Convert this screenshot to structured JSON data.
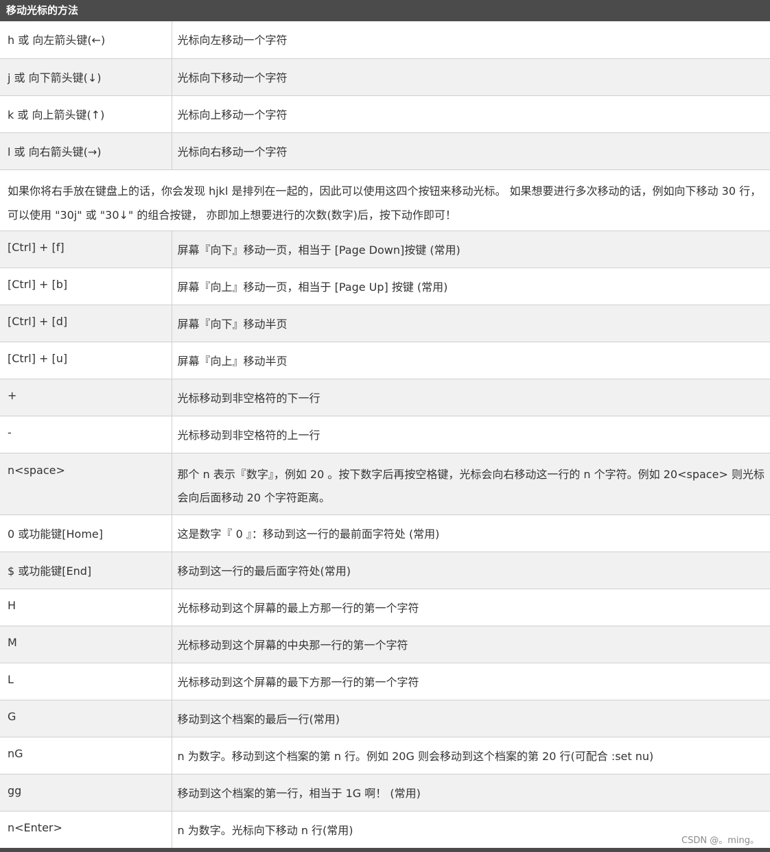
{
  "header": {
    "title": "移动光标的方法"
  },
  "rows": [
    {
      "key": "h 或 向左箭头键(←)",
      "desc": "光标向左移动一个字符"
    },
    {
      "key": "j 或 向下箭头键(↓)",
      "desc": "光标向下移动一个字符"
    },
    {
      "key": "k 或 向上箭头键(↑)",
      "desc": "光标向上移动一个字符"
    },
    {
      "key": "l 或 向右箭头键(→)",
      "desc": "光标向右移动一个字符"
    },
    {
      "note": "如果你将右手放在键盘上的话，你会发现 hjkl 是排列在一起的，因此可以使用这四个按钮来移动光标。 如果想要进行多次移动的话，例如向下移动 30 行，可以使用 \"30j\" 或 \"30↓\" 的组合按键， 亦即加上想要进行的次数(数字)后，按下动作即可！"
    },
    {
      "key": "[Ctrl] + [f]",
      "desc": "屏幕『向下』移动一页，相当于 [Page Down]按键 (常用)"
    },
    {
      "key": "[Ctrl] + [b]",
      "desc": "屏幕『向上』移动一页，相当于 [Page Up] 按键 (常用)"
    },
    {
      "key": "[Ctrl] + [d]",
      "desc": "屏幕『向下』移动半页"
    },
    {
      "key": "[Ctrl] + [u]",
      "desc": "屏幕『向上』移动半页"
    },
    {
      "key": "+",
      "desc": "光标移动到非空格符的下一行"
    },
    {
      "key": "-",
      "desc": "光标移动到非空格符的上一行"
    },
    {
      "key": "n<space>",
      "desc": "那个 n 表示『数字』，例如 20 。按下数字后再按空格键，光标会向右移动这一行的 n 个字符。例如 20<space> 则光标会向后面移动 20 个字符距离。"
    },
    {
      "key": "0 或功能键[Home]",
      "desc": "这是数字『 0 』：移动到这一行的最前面字符处 (常用)"
    },
    {
      "key": "$ 或功能键[End]",
      "desc": "移动到这一行的最后面字符处(常用)"
    },
    {
      "key": "H",
      "desc": "光标移动到这个屏幕的最上方那一行的第一个字符"
    },
    {
      "key": "M",
      "desc": "光标移动到这个屏幕的中央那一行的第一个字符"
    },
    {
      "key": "L",
      "desc": "光标移动到这个屏幕的最下方那一行的第一个字符"
    },
    {
      "key": "G",
      "desc": "移动到这个档案的最后一行(常用)"
    },
    {
      "key": "nG",
      "desc": "n 为数字。移动到这个档案的第 n 行。例如 20G 则会移动到这个档案的第 20 行(可配合 :set nu)"
    },
    {
      "key": "gg",
      "desc": "移动到这个档案的第一行，相当于 1G 啊！ (常用)"
    },
    {
      "key": "n<Enter>",
      "desc": "n 为数字。光标向下移动 n 行(常用)"
    }
  ],
  "watermark": "CSDN @。ming。"
}
